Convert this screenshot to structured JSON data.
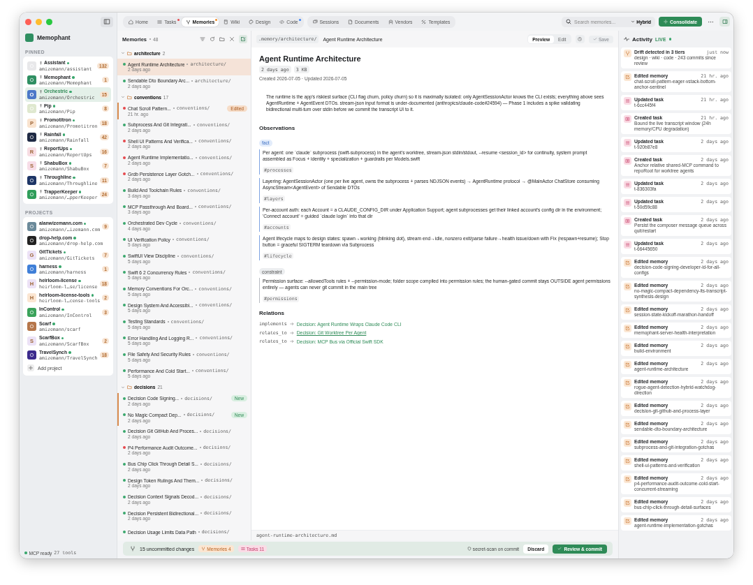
{
  "sidebar": {
    "app_name": "Memophant",
    "pinned_label": "PINNED",
    "pinned": [
      {
        "name": "Assistant",
        "path": "amizemann/assistant",
        "count": "132",
        "selected": false,
        "color": "#e8e8ea"
      },
      {
        "name": "Memophant",
        "path": "amizemann/Memophant",
        "count": "1",
        "selected": false,
        "color": "#2f8f62"
      },
      {
        "name": "Orchestric",
        "path": "amizemann/Orchestric",
        "count": "15",
        "selected": true,
        "color": "#4b78c8",
        "letter": "O"
      },
      {
        "name": "Pip",
        "path": "amizemann/Pip",
        "count": "8",
        "selected": false,
        "color": "#dfe8cf"
      },
      {
        "name": "Promotitron",
        "path": "amizemann/Promotitron",
        "count": "18",
        "selected": false,
        "color": "#f9e3cf",
        "letter": "P"
      },
      {
        "name": "Rainfall",
        "path": "amizemann/Rainfall",
        "count": "42",
        "selected": false,
        "color": "#1f2a44"
      },
      {
        "name": "ReportUps",
        "path": "amizemann/ReportUps",
        "count": "16",
        "selected": false,
        "color": "#f7dde3",
        "letter": "R"
      },
      {
        "name": "ShabuBox",
        "path": "amizemann/ShabuBox",
        "count": "7",
        "selected": false,
        "color": "#f7dde8",
        "letter": "S"
      },
      {
        "name": "Throughline",
        "path": "amizemann/Throughline",
        "count": "11",
        "selected": false,
        "color": "#1d3566"
      },
      {
        "name": "TrapperKeeper",
        "path": "amizemann/…pperKeeper",
        "count": "24",
        "selected": false,
        "color": "#2f9d5a"
      }
    ],
    "projects_label": "PROJECTS",
    "projects": [
      {
        "name": "alanwizemann.com",
        "path": "amizemann/…izemann.com",
        "count": "9",
        "selected": false,
        "color": "#6b8a9a"
      },
      {
        "name": "drop-help.com",
        "path": "amizemann/drop-help.com",
        "selected": false,
        "color": "#222222"
      },
      {
        "name": "GitTickets",
        "path": "amizemann/GitTickets",
        "count": "7",
        "selected": false,
        "color": "#ece2f6",
        "letter": "G"
      },
      {
        "name": "harness",
        "path": "amizemann/harness",
        "count": "1",
        "selected": false,
        "color": "#3f7fd8"
      },
      {
        "name": "heirloom-license",
        "path": "heirloom-l…se/license",
        "count": "18",
        "selected": false,
        "color": "#ece2f6",
        "letter": "H"
      },
      {
        "name": "heirloom-license-tools",
        "path": "heirloom-l…cense-tools",
        "count": "2",
        "selected": false,
        "color": "#fbe6d2",
        "letter": "H"
      },
      {
        "name": "InControl",
        "path": "amizemann/InControl",
        "count": "3",
        "selected": false,
        "color": "#3aa25a"
      },
      {
        "name": "Scarf",
        "path": "amizemann/scarf",
        "selected": false,
        "color": "#b5764a"
      },
      {
        "name": "ScarfBox",
        "path": "amizemann/ScarfBox",
        "count": "2",
        "selected": false,
        "color": "#ece2f6",
        "letter": "S"
      },
      {
        "name": "TravelSynch",
        "path": "amizemann/TravelSynch",
        "count": "18",
        "selected": false,
        "color": "#3b2a8c"
      }
    ],
    "add_project": "Add project",
    "status": "MCP ready",
    "tools": "27 tools"
  },
  "tab_groups": [
    {
      "tabs": [
        {
          "label": "Home",
          "selected": false
        },
        {
          "label": "Tasks",
          "selected": false,
          "color": "#e5484d"
        },
        {
          "label": "Memories",
          "selected": true,
          "color": "#f08a24"
        },
        {
          "label": "Wiki",
          "selected": false
        },
        {
          "label": "Design",
          "selected": false
        },
        {
          "label": "Code",
          "selected": false,
          "color": "#3b82f6"
        }
      ]
    },
    {
      "tabs": [
        {
          "label": "Sessions",
          "selected": false
        },
        {
          "label": "Documents",
          "selected": false
        },
        {
          "label": "Vendors",
          "selected": false
        },
        {
          "label": "Templates",
          "selected": false
        }
      ]
    }
  ],
  "search": {
    "placeholder": "Search memories..."
  },
  "search_mode": "Hybrid",
  "consolidate": "Consolidate",
  "memories": {
    "title": "Memories",
    "count": "48",
    "groups": [
      {
        "name": "architecture",
        "count": "2",
        "expanded": true,
        "items": [
          {
            "title": "Agent Runtime Architecture",
            "path": "architecture/",
            "time": "2 days ago",
            "color": "#3aa76d",
            "selected": true,
            "modified": false
          },
          {
            "title": "Sendable Dto Boundary Arc...",
            "path": "architecture/",
            "time": "2 days ago",
            "color": "#3aa76d",
            "selected": false,
            "modified": false
          }
        ]
      },
      {
        "name": "conventions",
        "count": "17",
        "expanded": true,
        "items": [
          {
            "title": "Chat Scroll Pattern...",
            "path": "conventions/",
            "time": "21 hr. ago",
            "color": "#e5484d",
            "selected": false,
            "modified": true,
            "badge": "Edited",
            "kind": "edited"
          },
          {
            "title": "Subprocess And Git Integrati...",
            "path": "conventions/",
            "time": "2 days ago",
            "color": "#3aa76d",
            "selected": false,
            "modified": false
          },
          {
            "title": "Shell UI Patterns And Verifica...",
            "path": "conventions/",
            "time": "2 days ago",
            "color": "#e5484d",
            "selected": false,
            "modified": false
          },
          {
            "title": "Agent Runtime Implementatio...",
            "path": "conventions/",
            "time": "2 days ago",
            "color": "#e5484d",
            "selected": false,
            "modified": false
          },
          {
            "title": "Grdb Persistence Layer Gotch...",
            "path": "conventions/",
            "time": "2 days ago",
            "color": "#e5484d",
            "selected": false,
            "modified": false
          },
          {
            "title": "Build And Toolchain Rules",
            "path": "conventions/",
            "time": "3 days ago",
            "color": "#3aa76d",
            "selected": false,
            "modified": false
          },
          {
            "title": "MCP Passthrough And Board...",
            "path": "conventions/",
            "time": "3 days ago",
            "color": "#3aa76d",
            "selected": false,
            "modified": false
          },
          {
            "title": "Orchestrated Dev Cycle",
            "path": "conventions/",
            "time": "4 days ago",
            "color": "#3aa76d",
            "selected": false,
            "modified": false
          },
          {
            "title": "UI Verification Policy",
            "path": "conventions/",
            "time": "5 days ago",
            "color": "#3aa76d",
            "selected": false,
            "modified": false
          },
          {
            "title": "SwiftUI View Discipline",
            "path": "conventions/",
            "time": "5 days ago",
            "color": "#3aa76d",
            "selected": false,
            "modified": false
          },
          {
            "title": "Swift 6 2 Concurrency Rules",
            "path": "conventions/",
            "time": "5 days ago",
            "color": "#3aa76d",
            "selected": false,
            "modified": false
          },
          {
            "title": "Memory Conventions For Orc...",
            "path": "conventions/",
            "time": "5 days ago",
            "color": "#3aa76d",
            "selected": false,
            "modified": false
          },
          {
            "title": "Design System And Accessibi...",
            "path": "conventions/",
            "time": "5 days ago",
            "color": "#3aa76d",
            "selected": false,
            "modified": false
          },
          {
            "title": "Testing Standards",
            "path": "conventions/",
            "time": "5 days ago",
            "color": "#3aa76d",
            "selected": false,
            "modified": false
          },
          {
            "title": "Error Handling And Logging R...",
            "path": "conventions/",
            "time": "5 days ago",
            "color": "#3aa76d",
            "selected": false,
            "modified": false
          },
          {
            "title": "File Safety And Security Rules",
            "path": "conventions/",
            "time": "5 days ago",
            "color": "#3aa76d",
            "selected": false,
            "modified": false
          },
          {
            "title": "Performance And Cold Start...",
            "path": "conventions/",
            "time": "5 days ago",
            "color": "#3aa76d",
            "selected": false,
            "modified": false
          }
        ]
      },
      {
        "name": "decisions",
        "count": "21",
        "expanded": true,
        "items": [
          {
            "title": "Decision Code Signing...",
            "path": "decisions/",
            "time": "2 days ago",
            "color": "#3aa76d",
            "selected": false,
            "modified": true,
            "badge": "New",
            "kind": "new"
          },
          {
            "title": "No Magic Compact Dep...",
            "path": "decisions/",
            "time": "2 days ago",
            "color": "#3aa76d",
            "selected": false,
            "modified": true,
            "badge": "New",
            "kind": "new"
          },
          {
            "title": "Decision Git GitHub And Proces...",
            "path": "decisions/",
            "time": "2 days ago",
            "color": "#3aa76d",
            "selected": false,
            "modified": false
          },
          {
            "title": "P4 Performance Audit Outcome...",
            "path": "decisions/",
            "time": "2 days ago",
            "color": "#e5484d",
            "selected": false,
            "modified": false
          },
          {
            "title": "Bus Chip Click Through Detail S...",
            "path": "decisions/",
            "time": "2 days ago",
            "color": "#3aa76d",
            "selected": false,
            "modified": false
          },
          {
            "title": "Design Token Rulings And Them...",
            "path": "decisions/",
            "time": "2 days ago",
            "color": "#3aa76d",
            "selected": false,
            "modified": false
          },
          {
            "title": "Decision Context Signals Decod...",
            "path": "decisions/",
            "time": "2 days ago",
            "color": "#3aa76d",
            "selected": false,
            "modified": false
          },
          {
            "title": "Decision Persistent Bidirectional...",
            "path": "decisions/",
            "time": "2 days ago",
            "color": "#3aa76d",
            "selected": false,
            "modified": false
          },
          {
            "title": "Decision Usage Limits Data Path",
            "path": "decisions/",
            "color": "#3aa76d",
            "selected": false,
            "modified": false
          }
        ]
      }
    ]
  },
  "document": {
    "breadcrumb": ".memory/architecture/",
    "header_title": "Agent Runtime Architecture",
    "modes": [
      {
        "label": "Preview",
        "selected": true
      },
      {
        "label": "Edit",
        "selected": false
      }
    ],
    "save": {
      "label": "Save",
      "disabled": true
    },
    "title": "Agent Runtime Architecture",
    "chips": [
      "2 days ago",
      "3 KB"
    ],
    "meta": "Created 2026-07-05 · Updated 2026-07-05",
    "summary": "The runtime is the app's riskiest surface (CLI flag churn, policy churn) so it is maximally isolated: only AgentSessionActor knows the CLI exists; everything above sees AgentRuntime + AgentEvent DTOs. stream-json input format is under-documented (anthropics/claude-code#24594) — Phase 1 includes a spike validating bidirectional multi-turn over stdin before we commit the transcript UI to it.",
    "observations_heading": "Observations",
    "observation_groups": [
      {
        "label": "fact",
        "kind": "fact",
        "items": [
          {
            "text": "Per agent: one `claude` subprocess (swift-subprocess) in the agent's worktree, stream-json stdin/stdout, --resume <session_id> for continuity, system prompt assembled as Focus + identity + specialization + guardrails per Models.swift",
            "tag": "#processes"
          },
          {
            "text": "Layering: AgentSessionActor (one per live agent, owns the subprocess + parses NDJSON events) → AgentRuntime protocol → @MainActor ChatStore consuming AsyncStream<AgentEvent> of Sendable DTOs",
            "tag": "#layers"
          },
          {
            "text": "Per-account auth: each Account = a CLAUDE_CONFIG_DIR under Application Support; agent subprocesses get their linked account's config dir in the environment; 'Connect account' = guided `claude login` into that dir",
            "tag": "#accounts"
          },
          {
            "text": "Agent lifecycle maps to design states: spawn→working (blinking dot), stream end→idle, nonzero exit/parse failure→health issue/down with Fix (respawn+resume); Stop button = graceful SIGTERM teardown via Subprocess",
            "tag": "#lifecycle"
          }
        ]
      },
      {
        "label": "constraint",
        "kind": "constraint",
        "items": [
          {
            "text": "Permission surface: --allowedTools rules + --permission-mode; folder scope compiled into permission rules; the human-gated commit stays OUTSIDE agent permissions entirely — agents can never git commit in the main tree",
            "tag": "#permissions"
          }
        ]
      }
    ],
    "relations_heading": "Relations",
    "relations": [
      {
        "type": "implements",
        "target": "Decision: Agent Runtime Wraps Claude Code CLI",
        "hovered": false
      },
      {
        "type": "relates_to",
        "target": "Decision: Git Worktree Per Agent",
        "hovered": true
      },
      {
        "type": "relates_to",
        "target": "Decision: MCP Bus via Official Swift SDK",
        "hovered": false
      }
    ],
    "filename": "agent-runtime-architecture.md"
  },
  "commit_bar": {
    "changes": "15 uncommitted changes",
    "chips": [
      {
        "label": "Memories 4",
        "kind": "memories"
      },
      {
        "label": "Tasks 11",
        "kind": "tasks"
      }
    ],
    "secret_scan": "secret-scan on commit",
    "discard": "Discard",
    "commit": "Review & commit"
  },
  "activity": {
    "title": "Activity",
    "live": "LIVE",
    "items": [
      {
        "kind": "drift",
        "title": "Drift detected in 3 tiers",
        "time": "just now",
        "detail": "design · wiki · code · 243 commits since review"
      },
      {
        "kind": "memory",
        "title": "Edited memory",
        "time": "21 hr. ago",
        "detail": "chat-scroll-pattern-eager-vstack-bottom-anchor-sentinel"
      },
      {
        "kind": "task_update",
        "title": "Updated task",
        "time": "21 hr. ago",
        "detail": "t-6cc445f4"
      },
      {
        "kind": "task_create",
        "title": "Created task",
        "time": "21 hr. ago",
        "detail": "Bound the live transcript window (24h memory/CPU degradation)"
      },
      {
        "kind": "task_update",
        "title": "Updated task",
        "time": "2 days ago",
        "detail": "t-920b87e8"
      },
      {
        "kind": "task_create",
        "title": "Created task",
        "time": "2 days ago",
        "detail": "Anchor relative shared-MCP command to repoRoot for worktree agents"
      },
      {
        "kind": "task_update",
        "title": "Updated task",
        "time": "2 days ago",
        "detail": "t-836303fa"
      },
      {
        "kind": "task_update",
        "title": "Updated task",
        "time": "2 days ago",
        "detail": "t-50d59c88"
      },
      {
        "kind": "task_create",
        "title": "Created task",
        "time": "2 days ago",
        "detail": "Persist the composer message queue across quit/restart"
      },
      {
        "kind": "task_update",
        "title": "Updated task",
        "time": "2 days ago",
        "detail": "t-66445650"
      },
      {
        "kind": "memory",
        "title": "Edited memory",
        "time": "2 days ago",
        "detail": "decision-code-signing-developer-id-for-all-configs"
      },
      {
        "kind": "memory",
        "title": "Edited memory",
        "time": "2 days ago",
        "detail": "no-magic-compact-dependency-lts-transcript-synthesis-design"
      },
      {
        "kind": "memory",
        "title": "Edited memory",
        "time": "2 days ago",
        "detail": "session-state-kickoff-marathon-handoff"
      },
      {
        "kind": "memory",
        "title": "Edited memory",
        "time": "2 days ago",
        "detail": "memophant-server-health-interpretation"
      },
      {
        "kind": "memory",
        "title": "Edited memory",
        "time": "2 days ago",
        "detail": "build-environment"
      },
      {
        "kind": "memory",
        "title": "Edited memory",
        "time": "2 days ago",
        "detail": "agent-runtime-architecture"
      },
      {
        "kind": "memory",
        "title": "Edited memory",
        "time": "2 days ago",
        "detail": "rogue-agent-detection-hybrid-watchdog-direction"
      },
      {
        "kind": "memory",
        "title": "Edited memory",
        "time": "2 days ago",
        "detail": "decision-git-github-and-process-layer"
      },
      {
        "kind": "memory",
        "title": "Edited memory",
        "time": "2 days ago",
        "detail": "sendable-dto-boundary-architecture"
      },
      {
        "kind": "memory",
        "title": "Edited memory",
        "time": "2 days ago",
        "detail": "subprocess-and-git-integration-gotchas"
      },
      {
        "kind": "memory",
        "title": "Edited memory",
        "time": "2 days ago",
        "detail": "shell-ui-patterns-and-verification"
      },
      {
        "kind": "memory",
        "title": "Edited memory",
        "time": "2 days ago",
        "detail": "p4-performance-audit-outcome-cold-start-concurrent-streaming"
      },
      {
        "kind": "memory",
        "title": "Edited memory",
        "time": "2 days ago",
        "detail": "bus-chip-click-through-detail-surfaces"
      },
      {
        "kind": "memory",
        "title": "Edited memory",
        "time": "2 days ago",
        "detail": "agent-runtime-implementation-gotchas"
      }
    ]
  }
}
